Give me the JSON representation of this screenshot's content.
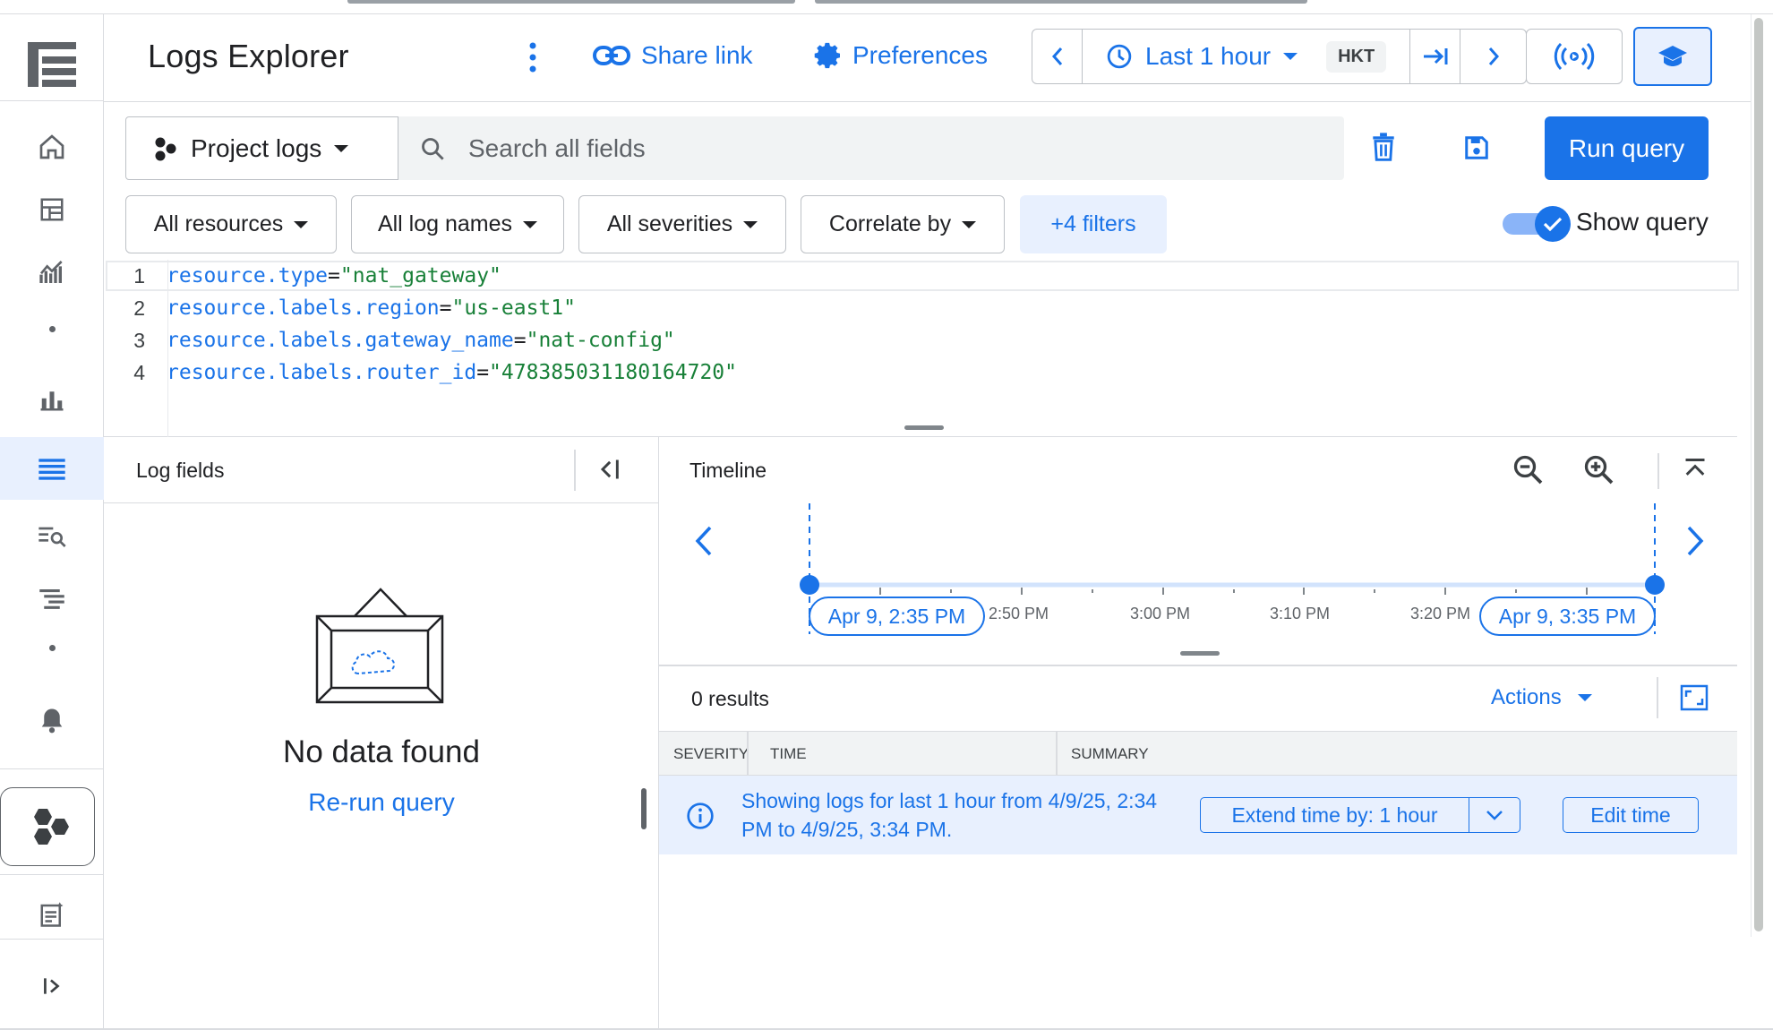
{
  "header": {
    "title": "Logs Explorer",
    "share_label": "Share link",
    "preferences_label": "Preferences",
    "time_range_label": "Last 1 hour",
    "timezone": "HKT"
  },
  "query": {
    "scope_label": "Project logs",
    "search_placeholder": "Search all fields",
    "run_label": "Run query",
    "show_query_label": "Show query",
    "show_query_on": true,
    "filters": [
      {
        "label": "All resources"
      },
      {
        "label": "All log names"
      },
      {
        "label": "All severities"
      },
      {
        "label": "Correlate by"
      },
      {
        "label": "+4 filters"
      }
    ],
    "lines": [
      {
        "num": "1",
        "key": "resource.type",
        "value": "\"nat_gateway\""
      },
      {
        "num": "2",
        "key": "resource.labels.region",
        "value": "\"us-east1\""
      },
      {
        "num": "3",
        "key": "resource.labels.gateway_name",
        "value": "\"nat-config\""
      },
      {
        "num": "4",
        "key": "resource.labels.router_id",
        "value": "\"478385031180164720\""
      }
    ]
  },
  "log_fields": {
    "title": "Log fields",
    "empty_title": "No data found",
    "rerun_label": "Re-run query"
  },
  "timeline": {
    "title": "Timeline",
    "start_label": "Apr 9, 2:35 PM",
    "end_label": "Apr 9, 3:35 PM",
    "ticks": [
      "2:50 PM",
      "3:00 PM",
      "3:10 PM",
      "3:20 PM"
    ]
  },
  "results": {
    "count_label": "0 results",
    "actions_label": "Actions",
    "columns": [
      "SEVERITY",
      "TIME",
      "SUMMARY"
    ],
    "info_text": "Showing logs for last 1 hour from 4/9/25, 2:34 PM to 4/9/25, 3:34 PM.",
    "extend_label": "Extend time by: 1 hour",
    "edit_time_label": "Edit time"
  },
  "colors": {
    "accent": "#1a73e8",
    "value_green": "#188038",
    "info_bg": "#e8f0fe"
  },
  "icons": [
    "menu-logo-icon",
    "home-icon",
    "dashboard-icon",
    "metrics-icon",
    "bar-chart-icon",
    "logs-list-icon",
    "log-search-icon",
    "traces-icon",
    "alert-bell-icon",
    "hexagons-icon",
    "notes-icon",
    "expand-rail-icon"
  ]
}
